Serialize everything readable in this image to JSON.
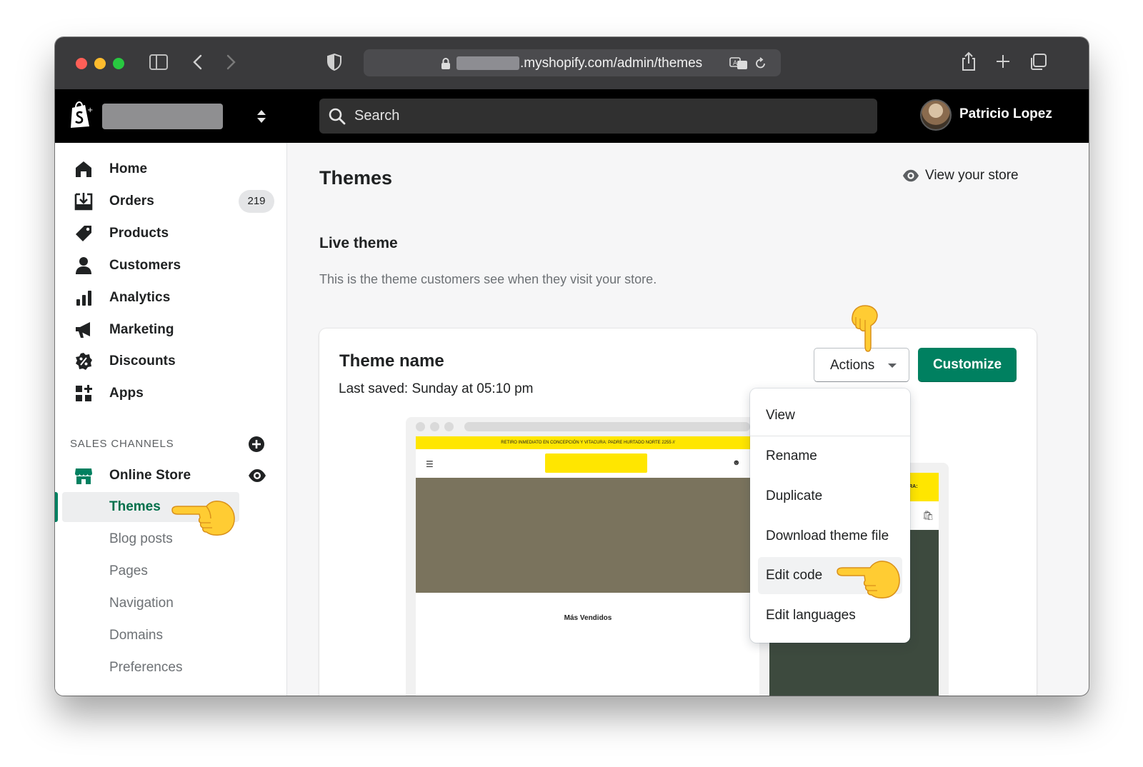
{
  "browser": {
    "url_suffix": ".myshopify.com/admin/themes"
  },
  "topbar": {
    "search_placeholder": "Search",
    "user_name": "Patricio Lopez"
  },
  "sidebar": {
    "items": [
      {
        "label": "Home",
        "icon": "home-icon"
      },
      {
        "label": "Orders",
        "icon": "orders-icon",
        "badge": "219"
      },
      {
        "label": "Products",
        "icon": "tag-icon"
      },
      {
        "label": "Customers",
        "icon": "person-icon"
      },
      {
        "label": "Analytics",
        "icon": "bar-chart-icon"
      },
      {
        "label": "Marketing",
        "icon": "megaphone-icon"
      },
      {
        "label": "Discounts",
        "icon": "discount-icon"
      },
      {
        "label": "Apps",
        "icon": "apps-icon"
      }
    ],
    "sales_channels_heading": "SALES CHANNELS",
    "online_store": "Online Store",
    "sub_items": [
      "Themes",
      "Blog posts",
      "Pages",
      "Navigation",
      "Domains",
      "Preferences"
    ],
    "active_sub_item": "Themes"
  },
  "main": {
    "page_title": "Themes",
    "view_store": "View your store",
    "live_theme_title": "Live theme",
    "live_theme_desc": "This is the theme customers see when they visit your store.",
    "card": {
      "theme_name": "Theme name",
      "last_saved": "Last saved: Sunday at 05:10 pm",
      "actions_label": "Actions",
      "customize_label": "Customize",
      "preview": {
        "announcement": "RETIRO INMEDIATO EN CONCEPCIÓN Y VITACURA: PADRE HURTADO NORTE 2255 //",
        "mobile_announcement": "CURA:",
        "section_heading": "Más Vendidos"
      }
    },
    "actions_menu": {
      "items": [
        "View",
        "Rename",
        "Duplicate",
        "Download theme file",
        "Edit code",
        "Edit languages"
      ],
      "highlighted": "Edit code"
    }
  },
  "colors": {
    "primary_button": "#008060",
    "active_nav": "#00704a",
    "preview_accent": "#ffe600",
    "topbar": "#000000"
  }
}
